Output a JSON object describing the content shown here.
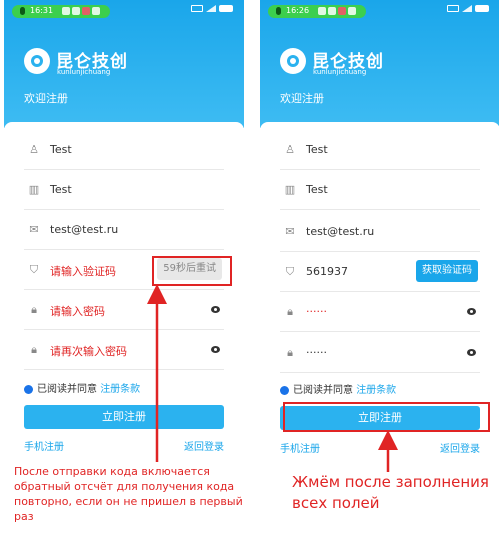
{
  "left_screen": {
    "status": {
      "time": "16:31"
    },
    "brand": {
      "name": "昆仑技创",
      "sub": "kunlunjichuang",
      "welcome": "欢迎注册"
    },
    "fields": {
      "username": "Test",
      "company": "Test",
      "email": "test@test.ru",
      "code": "请输入验证码",
      "code_button": "59秒后重试",
      "password": "请输入密码",
      "password_repeat": "请再次输入密码"
    },
    "agree": {
      "text": "已阅读并同意",
      "terms": "注册条款"
    },
    "submit": "立即注册",
    "links": {
      "phone_register": "手机注册",
      "back_login": "返回登录"
    }
  },
  "right_screen": {
    "status": {
      "time": "16:26"
    },
    "brand": {
      "name": "昆仑技创",
      "sub": "kunlunjichuang",
      "welcome": "欢迎注册"
    },
    "fields": {
      "username": "Test",
      "company": "Test",
      "email": "test@test.ru",
      "code": "561937",
      "code_button": "获取验证码",
      "password": "······",
      "password_repeat": "······"
    },
    "agree": {
      "text": "已阅读并同意",
      "terms": "注册条款"
    },
    "submit": "立即注册",
    "links": {
      "phone_register": "手机注册",
      "back_login": "返回登录"
    }
  },
  "annotations": {
    "left_note": "После отправки кода включается обратный отсчёт для получения кода повторно, если он не пришел в первый раз",
    "right_note": "Жмём после заполнения всех полей"
  },
  "colors": {
    "header": "#1aa6ea",
    "accent": "#2bb2ef",
    "annotation": "#e02424"
  }
}
